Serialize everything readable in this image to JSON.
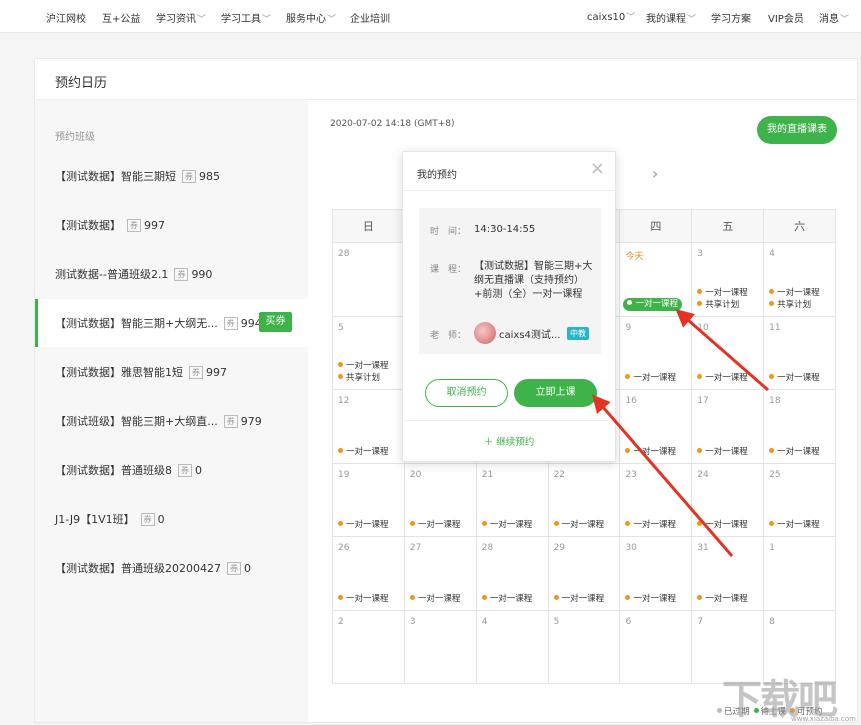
{
  "topnav": {
    "items": [
      {
        "label": "沪江网校",
        "chevron": false
      },
      {
        "label": "互+公益",
        "chevron": false
      },
      {
        "label": "学习资讯",
        "chevron": true
      },
      {
        "label": "学习工具",
        "chevron": true
      },
      {
        "label": "服务中心",
        "chevron": true
      },
      {
        "label": "企业培训",
        "chevron": false
      },
      {
        "label": "caixs10",
        "chevron": true
      },
      {
        "label": "我的课程",
        "chevron": true
      },
      {
        "label": "学习方案",
        "chevron": false
      },
      {
        "label": "VIP会员",
        "chevron": false
      },
      {
        "label": "消息",
        "chevron": true
      }
    ]
  },
  "page": {
    "title": "预约日历"
  },
  "sidebar": {
    "heading": "预约班级",
    "ticket_icon": "券",
    "buy_label": "买券",
    "classes": [
      {
        "name": "【测试数据】智能三期短",
        "count": "985"
      },
      {
        "name": "【测试数据】",
        "count": "997"
      },
      {
        "name": "测试数据--普通班级2.1",
        "count": "990"
      },
      {
        "name": "【测试数据】智能三期+大纲无...",
        "count": "994"
      },
      {
        "name": "【测试数据】雅思智能1短",
        "count": "997"
      },
      {
        "name": "【测试班级】智能三期+大纲直...",
        "count": "979"
      },
      {
        "name": "【测试数据】普通班级8",
        "count": "0"
      },
      {
        "name": "J1-J9【1V1班】",
        "count": "0"
      },
      {
        "name": "【测试数据】普通班级20200427",
        "count": "0"
      }
    ]
  },
  "calendar": {
    "datetime": "2020-07-02 14:18 (GMT+8)",
    "live_button": "我的直播课表",
    "next_icon": "chevron-right-icon",
    "next_glyph": "›",
    "weekdays": [
      "日",
      "一",
      "二",
      "三",
      "四",
      "五",
      "六"
    ],
    "ev_course": "一对一课程",
    "ev_share": "共享计划",
    "colors": {
      "orange": "#f0941e",
      "green": "#3db34a",
      "gray": "#bbbbbb"
    },
    "weeks": [
      [
        {
          "day": "28",
          "events": []
        },
        {
          "day": "",
          "events": []
        },
        {
          "day": "",
          "events": []
        },
        {
          "day": "",
          "events": []
        },
        {
          "day": "今天",
          "today": true,
          "events": [
            {
              "text": "一对一课程",
              "pill": true
            }
          ]
        },
        {
          "day": "3",
          "events": [
            {
              "text": "一对一课程",
              "color": "orange"
            },
            {
              "text": "共享计划",
              "color": "orange"
            }
          ]
        },
        {
          "day": "4",
          "events": [
            {
              "text": "一对一课程",
              "color": "orange"
            },
            {
              "text": "共享计划",
              "color": "orange"
            }
          ]
        }
      ],
      [
        {
          "day": "5",
          "events": [
            {
              "text": "一对一课程",
              "color": "orange"
            },
            {
              "text": "共享计划",
              "color": "orange"
            }
          ]
        },
        {
          "day": "",
          "events": []
        },
        {
          "day": "",
          "events": []
        },
        {
          "day": "",
          "events": []
        },
        {
          "day": "9",
          "events": [
            {
              "text": "一对一课程",
              "color": "orange"
            }
          ]
        },
        {
          "day": "10",
          "events": [
            {
              "text": "一对一课程",
              "color": "orange"
            }
          ]
        },
        {
          "day": "11",
          "events": [
            {
              "text": "一对一课程",
              "color": "orange"
            }
          ]
        }
      ],
      [
        {
          "day": "12",
          "events": [
            {
              "text": "一对一课程",
              "color": "orange"
            }
          ]
        },
        {
          "day": "",
          "events": []
        },
        {
          "day": "",
          "events": []
        },
        {
          "day": "",
          "events": []
        },
        {
          "day": "16",
          "events": [
            {
              "text": "一对一课程",
              "color": "orange"
            }
          ]
        },
        {
          "day": "17",
          "events": [
            {
              "text": "一对一课程",
              "color": "orange"
            }
          ]
        },
        {
          "day": "18",
          "events": [
            {
              "text": "一对一课程",
              "color": "orange"
            }
          ]
        }
      ],
      [
        {
          "day": "19",
          "events": [
            {
              "text": "一对一课程",
              "color": "orange"
            }
          ]
        },
        {
          "day": "20",
          "events": [
            {
              "text": "一对一课程",
              "color": "orange"
            }
          ]
        },
        {
          "day": "21",
          "events": [
            {
              "text": "一对一课程",
              "color": "orange"
            }
          ]
        },
        {
          "day": "22",
          "events": [
            {
              "text": "一对一课程",
              "color": "orange"
            }
          ]
        },
        {
          "day": "23",
          "events": [
            {
              "text": "一对一课程",
              "color": "orange"
            }
          ]
        },
        {
          "day": "24",
          "events": [
            {
              "text": "一对一课程",
              "color": "orange"
            }
          ]
        },
        {
          "day": "25",
          "events": [
            {
              "text": "一对一课程",
              "color": "orange"
            }
          ]
        }
      ],
      [
        {
          "day": "26",
          "events": [
            {
              "text": "一对一课程",
              "color": "orange"
            }
          ]
        },
        {
          "day": "27",
          "events": [
            {
              "text": "一对一课程",
              "color": "orange"
            }
          ]
        },
        {
          "day": "28",
          "events": [
            {
              "text": "一对一课程",
              "color": "orange"
            }
          ]
        },
        {
          "day": "29",
          "events": [
            {
              "text": "一对一课程",
              "color": "orange"
            }
          ]
        },
        {
          "day": "30",
          "events": [
            {
              "text": "一对一课程",
              "color": "orange"
            }
          ]
        },
        {
          "day": "31",
          "events": [
            {
              "text": "一对一课程",
              "color": "orange"
            }
          ]
        },
        {
          "day": "1",
          "events": []
        }
      ],
      [
        {
          "day": "2",
          "events": []
        },
        {
          "day": "3",
          "events": []
        },
        {
          "day": "4",
          "events": []
        },
        {
          "day": "5",
          "events": []
        },
        {
          "day": "6",
          "events": []
        },
        {
          "day": "7",
          "events": []
        },
        {
          "day": "8",
          "events": []
        }
      ]
    ]
  },
  "popup": {
    "title": "我的预约",
    "close_glyph": "×",
    "time_label": "时　间：",
    "time_value": "14:30-14:55",
    "course_label": "课　程：",
    "course_lines": [
      "【测试数据】智能三期+大",
      "纲无直播课（支持预约）",
      "+前测（全）一对一课程"
    ],
    "teacher_label": "老　师：",
    "teacher_name": "caixs4测试...",
    "teacher_badge": "中教",
    "cancel_label": "取消预约",
    "start_label": "立即上课",
    "continue_label": "＋ 继续预约"
  },
  "legend": [
    {
      "label": "已过期",
      "color": "gray"
    },
    {
      "label": "待上课",
      "color": "green"
    },
    {
      "label": "可预约",
      "color": "orange"
    }
  ],
  "watermark": {
    "main": "下载吧",
    "sub": "www.xiazaiba.com"
  }
}
